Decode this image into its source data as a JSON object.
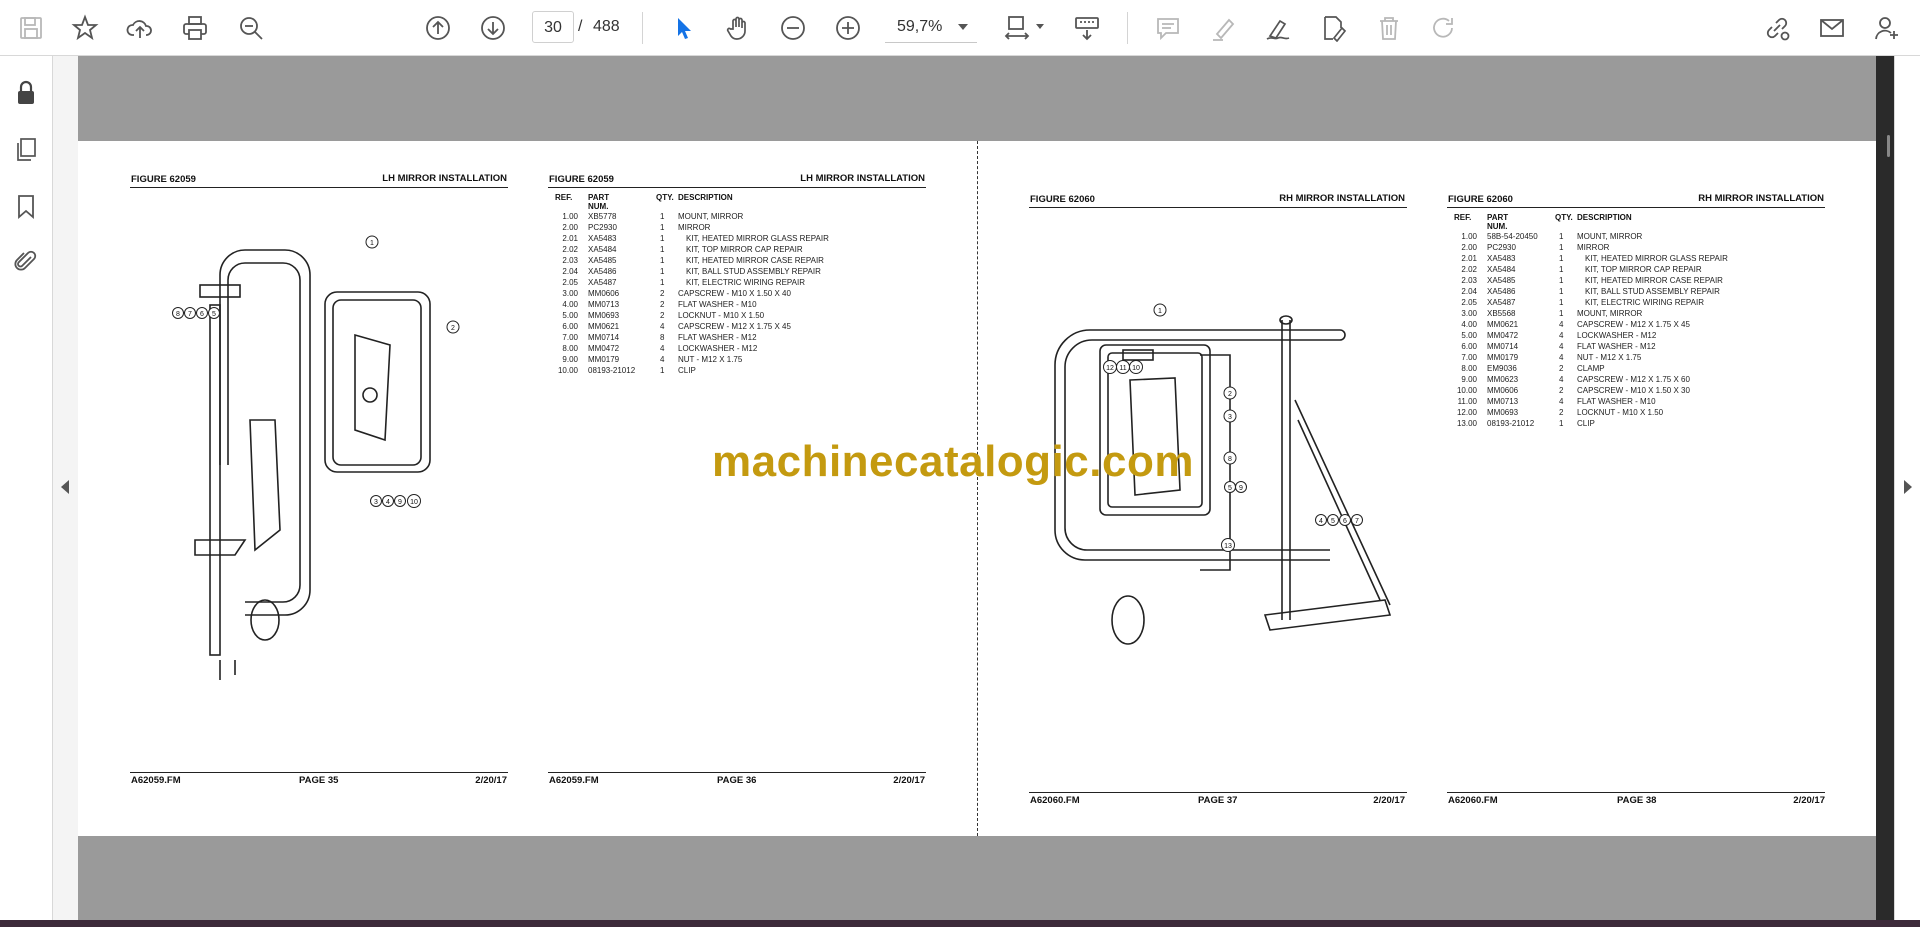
{
  "toolbar": {
    "page_current": "30",
    "page_separator": "/",
    "page_total": "488",
    "zoom": "59,7%",
    "icons": [
      "save-icon",
      "bookmark-star-icon",
      "cloud-upload-icon",
      "print-icon",
      "zoom-search-icon",
      "page-up-icon",
      "page-down-icon",
      "zoom-out-icon",
      "zoom-in-icon",
      "select-cursor-icon",
      "hand-pan-icon",
      "fit-page-icon",
      "scroll-mode-icon",
      "comment-icon",
      "highlight-icon",
      "sign-icon",
      "edit-pdf-icon",
      "delete-icon",
      "redo-icon",
      "share-link-icon",
      "email-icon",
      "account-icon"
    ],
    "accent_color": "#1473e6"
  },
  "sidebar": {
    "icons": [
      "lock-icon",
      "pages-icon",
      "bookmark-icon",
      "attachment-icon"
    ]
  },
  "watermark": "machinecatalogic.com",
  "pages": [
    {
      "figure": "FIGURE 62059",
      "title": "LH MIRROR INSTALLATION",
      "footer_file": "A62059.FM",
      "footer_page": "PAGE 35",
      "footer_date": "2/20/17",
      "callouts": [
        "1",
        "2",
        "8",
        "7",
        "6",
        "5",
        "3",
        "4",
        "9",
        "10"
      ]
    },
    {
      "figure": "FIGURE 62059",
      "title": "LH MIRROR INSTALLATION",
      "footer_file": "A62059.FM",
      "footer_page": "PAGE 36",
      "footer_date": "2/20/17",
      "columns": [
        "REF.",
        "PART NUM.",
        "QTY.",
        "DESCRIPTION"
      ],
      "rows": [
        [
          "1.00",
          "XB5778",
          "1",
          "MOUNT, MIRROR",
          0
        ],
        [
          "2.00",
          "PC2930",
          "1",
          "MIRROR",
          0
        ],
        [
          "2.01",
          "XA5483",
          "1",
          "KIT, HEATED MIRROR GLASS REPAIR",
          1
        ],
        [
          "2.02",
          "XA5484",
          "1",
          "KIT, TOP MIRROR CAP REPAIR",
          1
        ],
        [
          "2.03",
          "XA5485",
          "1",
          "KIT, HEATED MIRROR CASE REPAIR",
          1
        ],
        [
          "2.04",
          "XA5486",
          "1",
          "KIT, BALL STUD ASSEMBLY REPAIR",
          1
        ],
        [
          "2.05",
          "XA5487",
          "1",
          "KIT, ELECTRIC WIRING REPAIR",
          1
        ],
        [
          "3.00",
          "MM0606",
          "2",
          "CAPSCREW - M10 X 1.50 X 40",
          0
        ],
        [
          "4.00",
          "MM0713",
          "2",
          "FLAT WASHER - M10",
          0
        ],
        [
          "5.00",
          "MM0693",
          "2",
          "LOCKNUT - M10 X 1.50",
          0
        ],
        [
          "6.00",
          "MM0621",
          "4",
          "CAPSCREW - M12 X 1.75 X 45",
          0
        ],
        [
          "7.00",
          "MM0714",
          "8",
          "FLAT WASHER - M12",
          0
        ],
        [
          "8.00",
          "MM0472",
          "4",
          "LOCKWASHER - M12",
          0
        ],
        [
          "9.00",
          "MM0179",
          "4",
          "NUT - M12 X 1.75",
          0
        ],
        [
          "10.00",
          "08193-21012",
          "1",
          "CLIP",
          0
        ]
      ]
    },
    {
      "figure": "FIGURE 62060",
      "title": "RH MIRROR INSTALLATION",
      "footer_file": "A62060.FM",
      "footer_page": "PAGE 37",
      "footer_date": "2/20/17",
      "callouts": [
        "1",
        "12",
        "11",
        "10",
        "2",
        "3",
        "8",
        "5",
        "9",
        "4",
        "5",
        "6",
        "7",
        "13"
      ]
    },
    {
      "figure": "FIGURE 62060",
      "title": "RH MIRROR INSTALLATION",
      "footer_file": "A62060.FM",
      "footer_page": "PAGE 38",
      "footer_date": "2/20/17",
      "columns": [
        "REF.",
        "PART NUM.",
        "QTY.",
        "DESCRIPTION"
      ],
      "rows": [
        [
          "1.00",
          "58B-54-20450",
          "1",
          "MOUNT, MIRROR",
          0
        ],
        [
          "2.00",
          "PC2930",
          "1",
          "MIRROR",
          0
        ],
        [
          "2.01",
          "XA5483",
          "1",
          "KIT, HEATED MIRROR GLASS REPAIR",
          1
        ],
        [
          "2.02",
          "XA5484",
          "1",
          "KIT, TOP MIRROR CAP REPAIR",
          1
        ],
        [
          "2.03",
          "XA5485",
          "1",
          "KIT, HEATED MIRROR CASE REPAIR",
          1
        ],
        [
          "2.04",
          "XA5486",
          "1",
          "KIT, BALL STUD ASSEMBLY REPAIR",
          1
        ],
        [
          "2.05",
          "XA5487",
          "1",
          "KIT, ELECTRIC WIRING REPAIR",
          1
        ],
        [
          "3.00",
          "XB5568",
          "1",
          "MOUNT, MIRROR",
          0
        ],
        [
          "4.00",
          "MM0621",
          "4",
          "CAPSCREW - M12 X 1.75 X 45",
          0
        ],
        [
          "5.00",
          "MM0472",
          "4",
          "LOCKWASHER - M12",
          0
        ],
        [
          "6.00",
          "MM0714",
          "4",
          "FLAT WASHER - M12",
          0
        ],
        [
          "7.00",
          "MM0179",
          "4",
          "NUT - M12 X 1.75",
          0
        ],
        [
          "8.00",
          "EM9036",
          "2",
          "CLAMP",
          0
        ],
        [
          "9.00",
          "MM0623",
          "4",
          "CAPSCREW - M12 X 1.75 X 60",
          0
        ],
        [
          "10.00",
          "MM0606",
          "2",
          "CAPSCREW - M10 X 1.50 X 30",
          0
        ],
        [
          "11.00",
          "MM0713",
          "4",
          "FLAT WASHER - M10",
          0
        ],
        [
          "12.00",
          "MM0693",
          "2",
          "LOCKNUT - M10 X 1.50",
          0
        ],
        [
          "13.00",
          "08193-21012",
          "1",
          "CLIP",
          0
        ]
      ]
    }
  ]
}
